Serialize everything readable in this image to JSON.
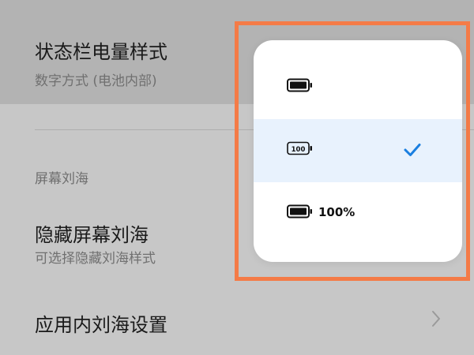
{
  "settings": {
    "battery_style": {
      "title": "状态栏电量样式",
      "value": "数字方式 (电池内部)"
    },
    "section_header": "屏幕刘海",
    "hide_notch": {
      "title": "隐藏屏幕刘海",
      "subtitle": "可选择隐藏刘海样式"
    },
    "app_notch": {
      "title": "应用内刘海设置"
    }
  },
  "popup": {
    "options": [
      {
        "icon": "battery-icon",
        "label": "",
        "selected": false
      },
      {
        "icon": "battery-number-inside-icon",
        "inner_text": "100",
        "selected": true
      },
      {
        "icon": "battery-number-beside-icon",
        "label": "100%",
        "selected": false
      }
    ],
    "check_icon": "checkmark-icon"
  },
  "colors": {
    "accent": "#1a7fe0",
    "highlight_frame": "#f47b47",
    "selected_row": "#e8f2fd"
  }
}
